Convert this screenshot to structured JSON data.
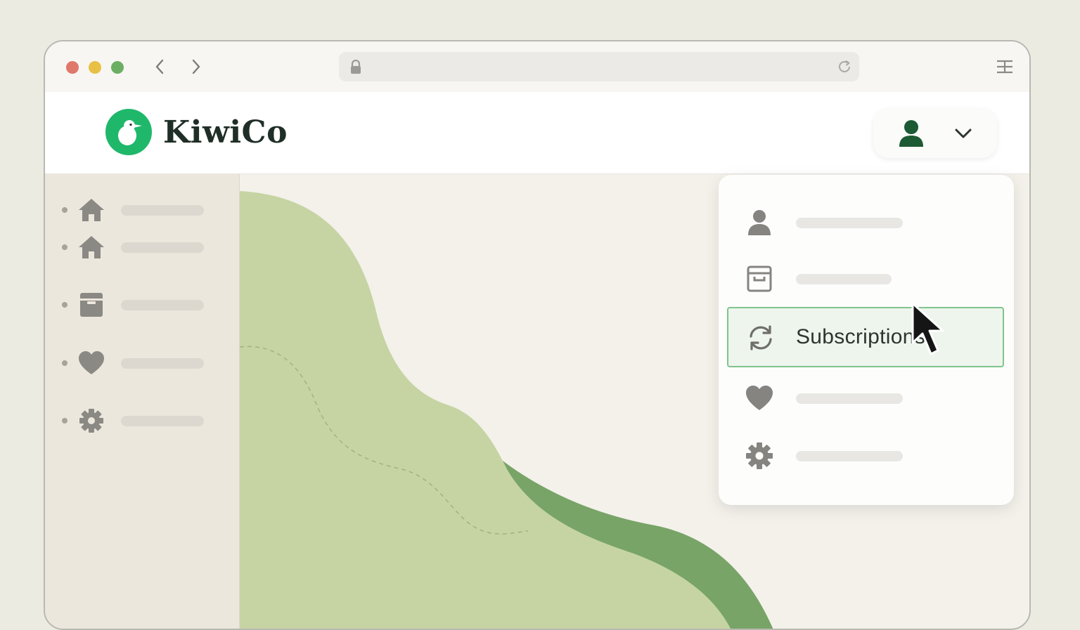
{
  "brand": {
    "name": "KiwiCo",
    "color": "#1fb86a",
    "text_color": "#1f2e27"
  },
  "browser": {
    "traffic_lights": [
      "#e0776b",
      "#e8c046",
      "#6caf64"
    ],
    "back_icon": "chevron-left-icon",
    "forward_icon": "chevron-right-icon",
    "url_icon": "lock-icon",
    "reload_icon": "reload-icon",
    "menu_icon": "menu-icon"
  },
  "account": {
    "icon": "user-icon",
    "toggle_icon": "chevron-down-icon"
  },
  "sidebar": {
    "items": [
      {
        "icon": "home-icon"
      },
      {
        "icon": "home-icon"
      },
      {
        "icon": "box-icon"
      },
      {
        "icon": "heart-icon"
      },
      {
        "icon": "gear-icon"
      }
    ]
  },
  "dropdown": {
    "items": [
      {
        "icon": "user-icon",
        "label": ""
      },
      {
        "icon": "box-icon",
        "label": ""
      },
      {
        "icon": "refresh-icon",
        "label": "Subscriptions",
        "highlighted": true
      },
      {
        "icon": "heart-icon",
        "label": ""
      },
      {
        "icon": "gear-icon",
        "label": ""
      }
    ]
  },
  "colors": {
    "background": "#ecebe2",
    "sidebar": "#ece7dd",
    "shape_light": "#c6d4a4",
    "shape_dark": "#78a467",
    "highlight_border": "#80c48d"
  }
}
